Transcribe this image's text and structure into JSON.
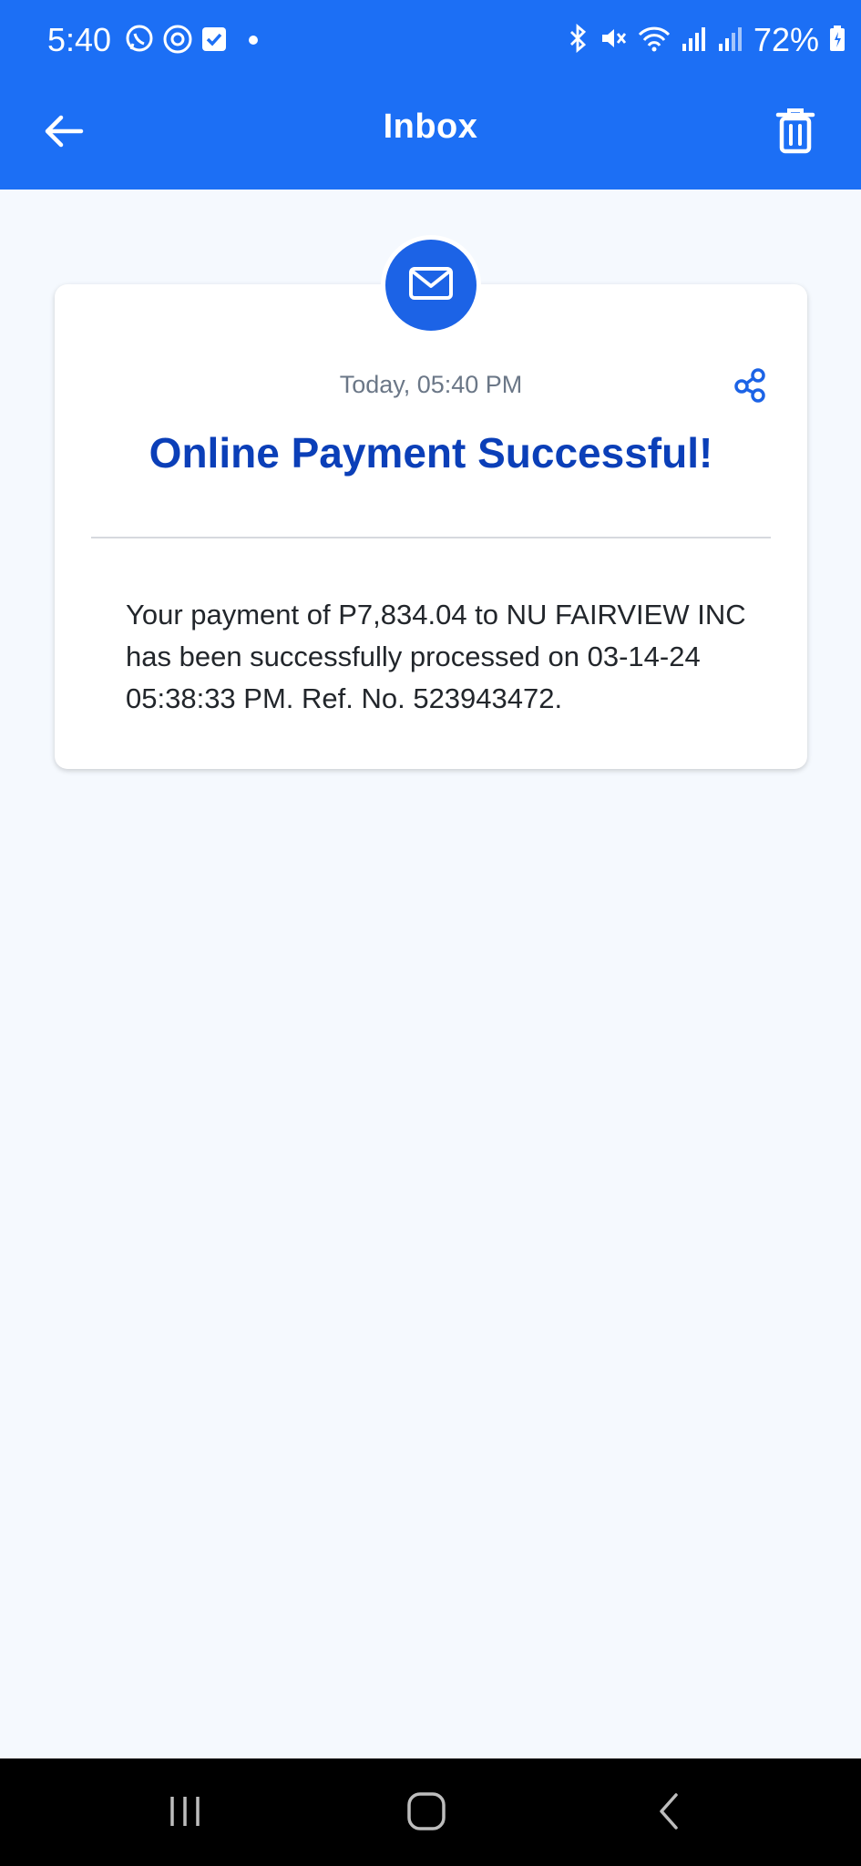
{
  "status_bar": {
    "time": "5:40",
    "battery": "72%",
    "left_icons": [
      "viber-icon",
      "threads-icon",
      "check-box-icon",
      "dot-icon"
    ],
    "right_icons": [
      "bluetooth-icon",
      "mute-icon",
      "wifi-icon",
      "signal-icon",
      "signal-icon-2",
      "battery-charging-icon"
    ]
  },
  "app_bar": {
    "title": "Inbox",
    "back_icon": "arrow-left-icon",
    "delete_icon": "trash-icon"
  },
  "message": {
    "icon": "envelope-icon",
    "date": "Today, 05:40 PM",
    "share_icon": "share-icon",
    "title": "Online Payment Successful!",
    "body": "Your payment of P7,834.04 to NU FAIRVIEW INC has been successfully processed on 03-14-24 05:38:33 PM. Ref. No. 523943472."
  },
  "nav_bar": {
    "recents_icon": "recents-icon",
    "home_icon": "home-icon",
    "back_icon": "back-chevron-icon"
  },
  "colors": {
    "primary": "#1c6ff5",
    "title": "#0b3fb8",
    "background": "#f5f9fe"
  }
}
